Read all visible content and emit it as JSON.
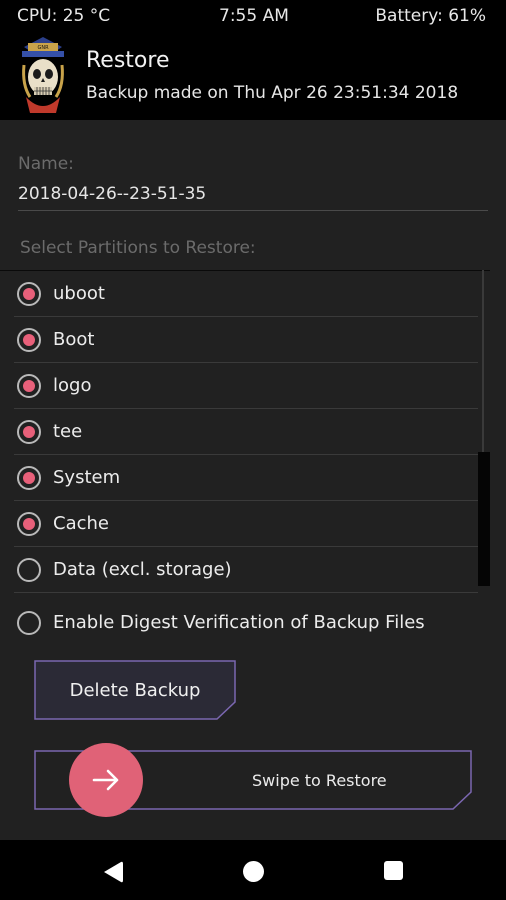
{
  "status_bar": {
    "cpu": "CPU: 25 °C",
    "time": "7:55 AM",
    "battery": "Battery: 61%"
  },
  "header": {
    "logo_icon": "skull-logo-icon",
    "title": "Restore",
    "subtitle": "Backup made on Thu Apr 26 23:51:34 2018"
  },
  "backup": {
    "name_label": "Name:",
    "name_value": "2018-04-26--23-51-35"
  },
  "partitions": {
    "label": "Select Partitions to Restore:",
    "items": [
      {
        "label": "uboot",
        "selected": true
      },
      {
        "label": "Boot",
        "selected": true
      },
      {
        "label": "logo",
        "selected": true
      },
      {
        "label": "tee",
        "selected": true
      },
      {
        "label": "System",
        "selected": true
      },
      {
        "label": "Cache",
        "selected": true
      },
      {
        "label": "Data (excl. storage)",
        "selected": false
      }
    ]
  },
  "digest": {
    "label": "Enable Digest Verification of Backup Files",
    "selected": false
  },
  "buttons": {
    "delete_label": "Delete Backup",
    "swipe_label": "Swipe to Restore"
  },
  "colors": {
    "accent": "#e06277",
    "button_border": "#7b67b0",
    "panel_bg": "#212121"
  }
}
